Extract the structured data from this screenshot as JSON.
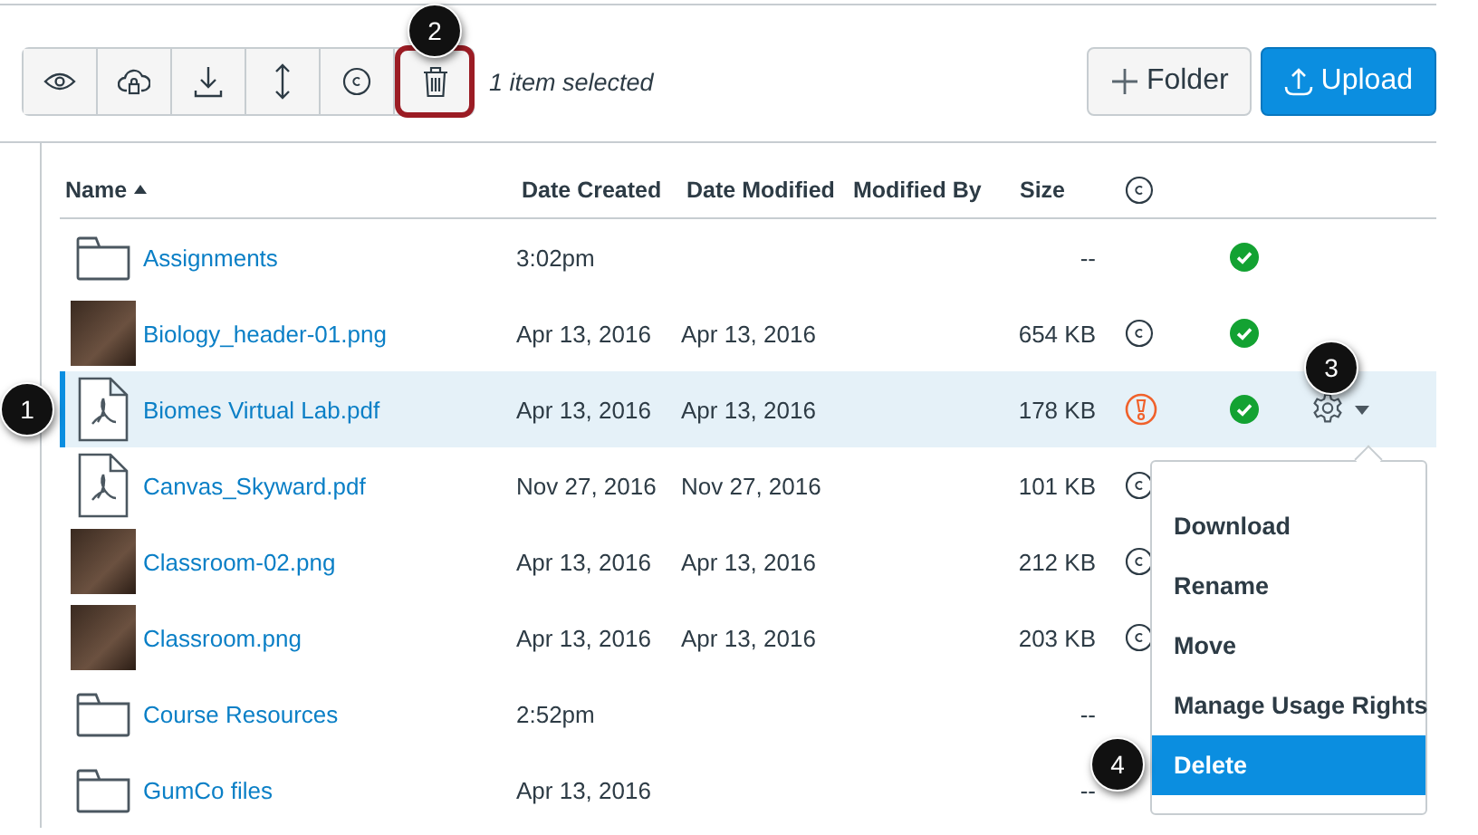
{
  "toolbar": {
    "buttons": [
      {
        "kind": "view",
        "highlighted": false
      },
      {
        "kind": "publish",
        "highlighted": false
      },
      {
        "kind": "download",
        "highlighted": false
      },
      {
        "kind": "move",
        "highlighted": false
      },
      {
        "kind": "usage",
        "highlighted": false
      },
      {
        "kind": "delete",
        "highlighted": true
      }
    ],
    "selection_text": "1 item selected",
    "actions": [
      {
        "kind": "folder",
        "label": "Folder"
      },
      {
        "kind": "upload",
        "label": "Upload"
      }
    ]
  },
  "table": {
    "columns": [
      {
        "label": "Name",
        "sorted": true
      },
      {
        "label": "Date Created",
        "sorted": false
      },
      {
        "label": "Date Modified",
        "sorted": false
      },
      {
        "label": "Modified By",
        "sorted": false
      },
      {
        "label": "Size",
        "sorted": false
      },
      {
        "kind": "usage"
      }
    ],
    "rows": [
      {
        "kind": "folder",
        "name": "Assignments",
        "created": "3:02pm",
        "size": "--",
        "published": true,
        "selected": false
      },
      {
        "kind": "image",
        "name": "Biology_header-01.png",
        "created": "Apr 13, 2016",
        "modified": "Apr 13, 2016",
        "size": "654 KB",
        "usage": {
          "kind": "copyright"
        },
        "published": true,
        "selected": false
      },
      {
        "kind": "pdf",
        "name": "Biomes Virtual Lab.pdf",
        "created": "Apr 13, 2016",
        "modified": "Apr 13, 2016",
        "size": "178 KB",
        "usage": {
          "kind": "warning"
        },
        "published": true,
        "selected": true
      },
      {
        "kind": "pdf",
        "name": "Canvas_Skyward.pdf",
        "created": "Nov 27, 2016",
        "modified": "Nov 27, 2016",
        "size": "101 KB",
        "usage": {
          "kind": "copyright"
        },
        "selected": false
      },
      {
        "kind": "image",
        "name": "Classroom-02.png",
        "created": "Apr 13, 2016",
        "modified": "Apr 13, 2016",
        "size": "212 KB",
        "usage": {
          "kind": "copyright"
        },
        "selected": false
      },
      {
        "kind": "image",
        "name": "Classroom.png",
        "created": "Apr 13, 2016",
        "modified": "Apr 13, 2016",
        "size": "203 KB",
        "usage": {
          "kind": "copyright"
        },
        "selected": false
      },
      {
        "kind": "folder",
        "name": "Course Resources",
        "created": "2:52pm",
        "size": "--",
        "selected": false
      },
      {
        "kind": "folder",
        "name": "GumCo files",
        "created": "Apr 13, 2016",
        "size": "--",
        "selected": false
      }
    ]
  },
  "menu": {
    "items": [
      {
        "label": "Download",
        "selected": false
      },
      {
        "label": "Rename",
        "selected": false
      },
      {
        "label": "Move",
        "selected": false
      },
      {
        "label": "Manage Usage Rights",
        "selected": false
      },
      {
        "label": "Delete",
        "selected": true
      }
    ]
  },
  "callouts": [
    {
      "label": "1"
    },
    {
      "label": "2"
    },
    {
      "label": "3"
    },
    {
      "label": "4"
    }
  ]
}
